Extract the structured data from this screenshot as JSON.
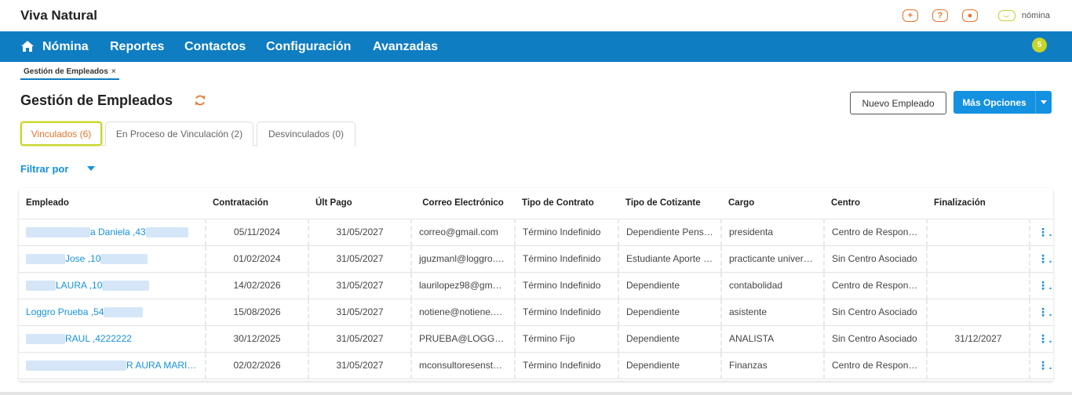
{
  "app": {
    "brand": "Viva Natural",
    "top_icons": [
      "plus-icon",
      "help-icon",
      "user-icon"
    ],
    "nomina_label": "nómina"
  },
  "nav": {
    "items": [
      "Nómina",
      "Reportes",
      "Contactos",
      "Configuración",
      "Avanzadas"
    ],
    "badge_count": "5",
    "color": "#0f7dc2"
  },
  "breadcrumb": {
    "label": "Gestión de Empleados",
    "close": "×"
  },
  "page": {
    "title": "Gestión de Empleados",
    "new_button": "Nuevo Empleado",
    "more_button": "Más Opciones",
    "filter_label": "Filtrar por"
  },
  "tabs": [
    {
      "label": "Vinculados (6)",
      "active": true
    },
    {
      "label": "En Proceso de Vinculación (2)",
      "active": false
    },
    {
      "label": "Desvinculados (0)",
      "active": false
    }
  ],
  "table": {
    "headers": [
      "Empleado",
      "Contratación",
      "Últ Pago",
      "Correo Electrónico",
      "Tipo de Contrato",
      "Tipo de Cotizante",
      "Cargo",
      "Centro",
      "Finalización"
    ],
    "rows": [
      {
        "empleado": "a Daniela ,43",
        "contratacion": "05/11/2024",
        "ult_pago": "31/05/2027",
        "correo": "correo@gmail.com",
        "tipo_contrato": "Término Indefinido",
        "tipo_cotizante": "Dependiente Pens…",
        "cargo": "presidenta",
        "centro": "Centro de Respon…",
        "finalizacion": ""
      },
      {
        "empleado": "Jose ,10",
        "contratacion": "01/02/2024",
        "ult_pago": "31/05/2027",
        "correo": "jguzmanl@loggro.…",
        "tipo_contrato": "Término Indefinido",
        "tipo_cotizante": "Estudiante Aporte …",
        "cargo": "practicante univer…",
        "centro": "Sin Centro Asociado",
        "finalizacion": ""
      },
      {
        "empleado": "LAURA ,10",
        "contratacion": "14/02/2026",
        "ult_pago": "31/05/2027",
        "correo": "laurilopez98@gm…",
        "tipo_contrato": "Término Indefinido",
        "tipo_cotizante": "Dependiente",
        "cargo": "contabolidad",
        "centro": "Centro de Respon…",
        "finalizacion": ""
      },
      {
        "empleado": "Loggro Prueba ,54",
        "contratacion": "15/08/2026",
        "ult_pago": "31/05/2027",
        "correo": "notiene@notiene.…",
        "tipo_contrato": "Término Indefinido",
        "tipo_cotizante": "Dependiente",
        "cargo": "asistente",
        "centro": "Sin Centro Asociado",
        "finalizacion": ""
      },
      {
        "empleado": "RAUL ,4222222",
        "contratacion": "30/12/2025",
        "ult_pago": "31/05/2027",
        "correo": "PRUEBA@LOGGR…",
        "tipo_contrato": "Término Fijo",
        "tipo_cotizante": "Dependiente",
        "cargo": "ANALISTA",
        "centro": "Sin Centro Asociado",
        "finalizacion": "31/12/2027"
      },
      {
        "empleado": "R AURA MARIA …",
        "contratacion": "02/02/2026",
        "ult_pago": "31/05/2027",
        "correo": "mconsultoresenst…",
        "tipo_contrato": "Término Indefinido",
        "tipo_cotizante": "Dependiente",
        "cargo": "Finanzas",
        "centro": "Centro de Respon…",
        "finalizacion": ""
      }
    ],
    "row_menu": "⋮"
  },
  "colors": {
    "accent": "#1491e0",
    "orange": "#e8742b",
    "lime": "#c7d52a"
  }
}
